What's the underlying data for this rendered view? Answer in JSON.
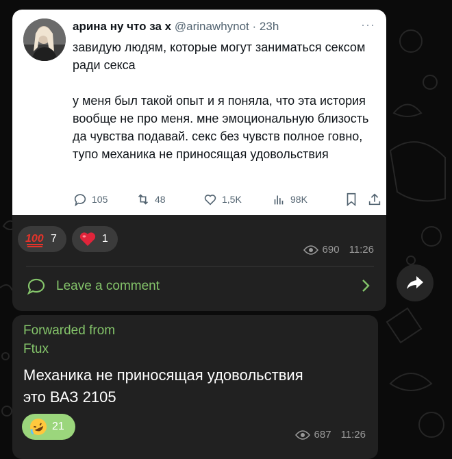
{
  "post": {
    "tweet": {
      "name": "арина ну что за х",
      "handle": "@arinawhynot",
      "time": "· 23h",
      "more": "···",
      "text": "завидую людям, которые могут заниматься сексом ради секса\n\nу меня был такой опыт и я поняла, что эта история вообще не про меня. мне эмоциональную близость да чувства подавай. секс без чувств полное говно, тупо механика не приносящая удовольствия",
      "replies": "105",
      "retweets": "48",
      "likes": "1,5K",
      "views": "98K"
    },
    "reactions": [
      {
        "emoji": "100-emoji",
        "count": "7"
      },
      {
        "emoji": "red-heart-emoji",
        "count": "1"
      }
    ],
    "views": "690",
    "time": "11:26",
    "comment_label": "Leave a comment"
  },
  "forwarded": {
    "label": "Forwarded from",
    "source": "Ftux",
    "text": "Механика не приносящая удовольствия\nэто ВАЗ 2105",
    "reaction": {
      "emoji": "rofl-emoji",
      "count": "21"
    },
    "views": "687",
    "time": "11:26"
  },
  "colors": {
    "background": "#0b0b0b",
    "bubble": "#212121",
    "accent_green": "#84c46a",
    "own_reaction": "#9bd67c",
    "meta_gray": "#9a9a9a"
  }
}
